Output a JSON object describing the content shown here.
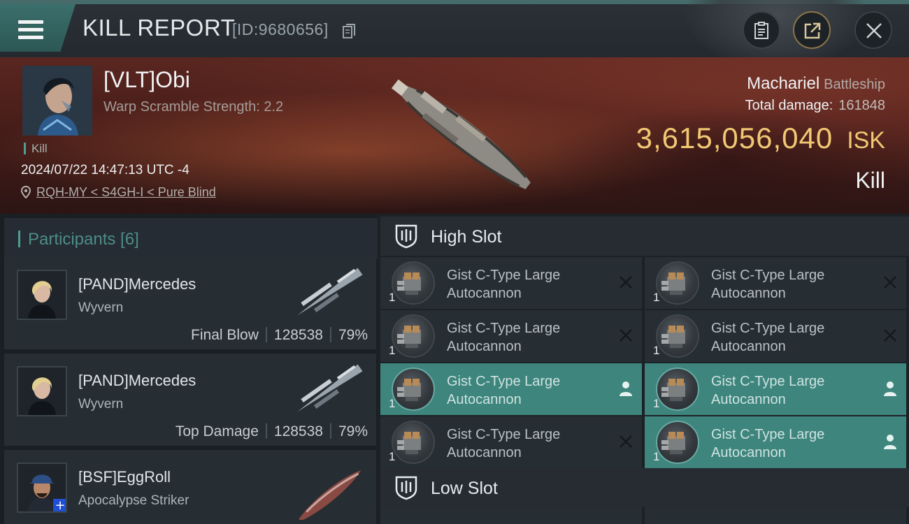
{
  "header": {
    "title": "KILL REPORT",
    "report_id": "[ID:9680656]"
  },
  "victim": {
    "name": "[VLT]Obi",
    "scramble": "Warp Scramble Strength: 2.2",
    "tag": "Kill",
    "datetime": "2024/07/22 14:47:13 UTC -4",
    "location": "RQH-MY < S4GH-I < Pure Blind",
    "ship": "Machariel",
    "ship_class": "Battleship",
    "total_damage_label": "Total damage:",
    "total_damage": "161848",
    "isk_value": "3,615,056,040",
    "isk_unit": "ISK",
    "result": "Kill"
  },
  "participants": {
    "label": "Participants [6]",
    "items": [
      {
        "name": "[PAND]Mercedes",
        "ship": "Wyvern",
        "role": "Final Blow",
        "damage": "128538",
        "percent": "79%"
      },
      {
        "name": "[PAND]Mercedes",
        "ship": "Wyvern",
        "role": "Top Damage",
        "damage": "128538",
        "percent": "79%"
      },
      {
        "name": "[BSF]EggRoll",
        "ship": "Apocalypse Striker"
      }
    ]
  },
  "slots": {
    "high_label": "High Slot",
    "low_label": "Low Slot",
    "high_modules": [
      {
        "line1": "Gist C-Type Large",
        "line2": "Autocannon",
        "qty": "1",
        "status": "destroyed"
      },
      {
        "line1": "Gist C-Type Large",
        "line2": "Autocannon",
        "qty": "1",
        "status": "destroyed"
      },
      {
        "line1": "Gist C-Type Large",
        "line2": "Autocannon",
        "qty": "1",
        "status": "destroyed"
      },
      {
        "line1": "Gist C-Type Large",
        "line2": "Autocannon",
        "qty": "1",
        "status": "destroyed"
      },
      {
        "line1": "Gist C-Type Large",
        "line2": "Autocannon",
        "qty": "1",
        "status": "dropped"
      },
      {
        "line1": "Gist C-Type Large",
        "line2": "Autocannon",
        "qty": "1",
        "status": "dropped"
      },
      {
        "line1": "Gist C-Type Large",
        "line2": "Autocannon",
        "qty": "1",
        "status": "destroyed"
      },
      {
        "line1": "Gist C-Type Large",
        "line2": "Autocannon",
        "qty": "1",
        "status": "dropped"
      }
    ]
  },
  "colors": {
    "accent_teal": "#3d857d",
    "isk_gold": "#f1c873",
    "hero_red": "#5a2620"
  }
}
